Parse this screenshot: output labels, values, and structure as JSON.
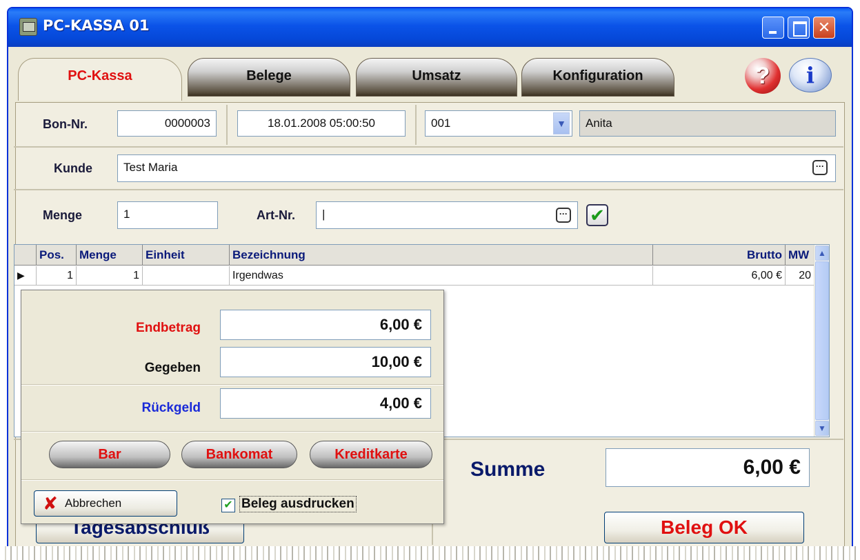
{
  "window": {
    "title": "PC-KASSA  01",
    "controls": {
      "minimize": "",
      "maximize": "",
      "close": "✕"
    }
  },
  "tabs": [
    {
      "label": "PC-Kassa",
      "active": true
    },
    {
      "label": "Belege",
      "active": false
    },
    {
      "label": "Umsatz",
      "active": false
    },
    {
      "label": "Konfiguration",
      "active": false
    }
  ],
  "header_icons": {
    "help": "?",
    "info": "i"
  },
  "bon": {
    "label": "Bon-Nr.",
    "number": "0000003",
    "datetime": "18.01.2008 05:00:50",
    "kasse": "001",
    "user": "Anita"
  },
  "kunde": {
    "label": "Kunde",
    "value": "Test Maria",
    "lookup": "···"
  },
  "entry": {
    "menge_label": "Menge",
    "menge_value": "1",
    "artnr_label": "Art-Nr.",
    "artnr_value": "|",
    "lookup": "···",
    "confirm": "✔"
  },
  "grid": {
    "columns": [
      "Pos.",
      "Menge",
      "Einheit",
      "Bezeichnung",
      "Brutto",
      "MW"
    ],
    "rows": [
      {
        "pos": "1",
        "menge": "1",
        "einheit": "",
        "bezeichnung": "Irgendwas",
        "brutto": "6,00 €",
        "mw": "20"
      }
    ],
    "row_marker": "▶",
    "scroll_up": "▲",
    "scroll_down": "▼"
  },
  "payment_dialog": {
    "endbetrag_label": "Endbetrag",
    "endbetrag_value": "6,00 €",
    "gegeben_label": "Gegeben",
    "gegeben_value": "10,00 €",
    "rueckgeld_label": "Rückgeld",
    "rueckgeld_value": "4,00 €",
    "buttons": {
      "bar": "Bar",
      "bankomat": "Bankomat",
      "kreditkarte": "Kreditkarte"
    },
    "abbrechen": "Abbrechen",
    "abbrechen_icon": "✘",
    "print_checkbox": {
      "label": "Beleg ausdrucken",
      "checked": true,
      "mark": "✔"
    }
  },
  "summary": {
    "label": "Summe",
    "value": "6,00 €"
  },
  "actions": {
    "beleg_ok": "Beleg OK",
    "tagesabschluss": "Tagesabschluß"
  }
}
